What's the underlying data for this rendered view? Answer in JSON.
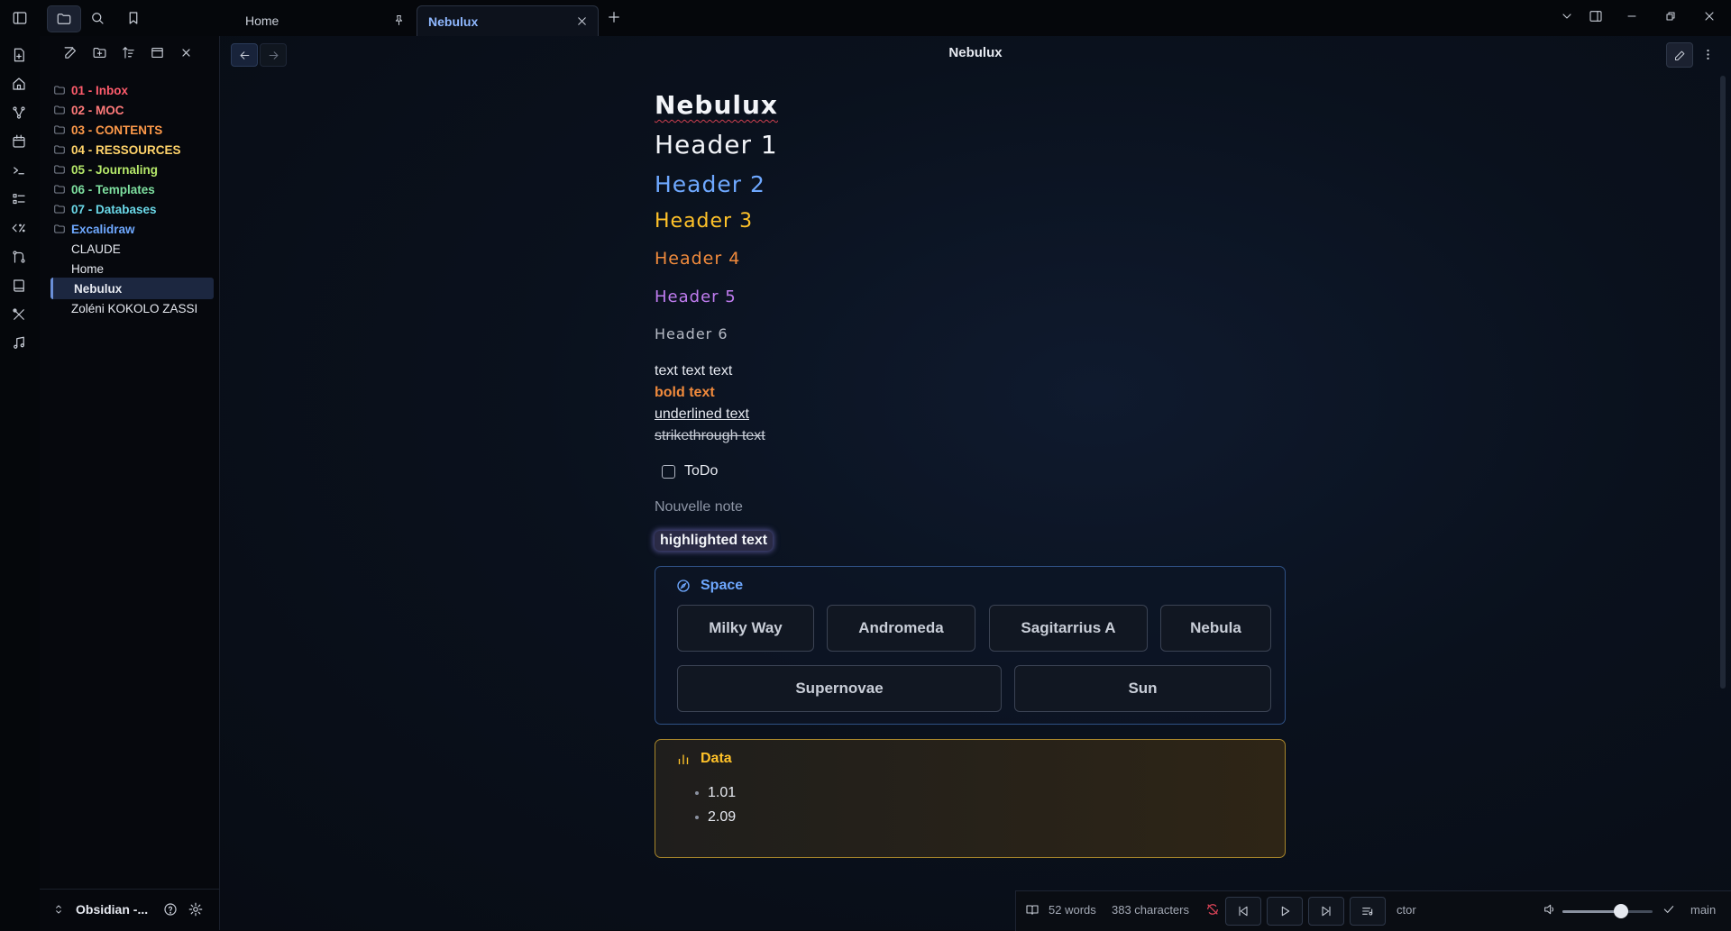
{
  "tabs": [
    {
      "label": "Home",
      "pinned": true
    },
    {
      "label": "Nebulux",
      "active": true
    }
  ],
  "sidebar": {
    "tree": [
      {
        "label": "01 - Inbox",
        "type": "folder",
        "color": "#ff5c6c"
      },
      {
        "label": "02 - MOC",
        "type": "folder",
        "color": "#ff7a7a"
      },
      {
        "label": "03 - CONTENTS",
        "type": "folder",
        "color": "#ff9a4a"
      },
      {
        "label": "04 - RESSOURCES",
        "type": "folder",
        "color": "#ffd36a"
      },
      {
        "label": "05 - Journaling",
        "type": "folder",
        "color": "#b5e86a"
      },
      {
        "label": "06 - Templates",
        "type": "folder",
        "color": "#7ee0a0"
      },
      {
        "label": "07 - Databases",
        "type": "folder",
        "color": "#6ad8e8"
      },
      {
        "label": "Excalidraw",
        "type": "folder",
        "color": "#6ea8ff"
      },
      {
        "label": "CLAUDE",
        "type": "file"
      },
      {
        "label": "Home",
        "type": "file"
      },
      {
        "label": "Nebulux",
        "type": "file",
        "selected": true
      },
      {
        "label": "Zoléni KOKOLO ZASSI",
        "type": "file"
      }
    ],
    "vault_name": "Obsidian -..."
  },
  "view": {
    "title": "Nebulux"
  },
  "document": {
    "inline_title": "Nebulux",
    "headers": [
      "Header 1",
      "Header 2",
      "Header 3",
      "Header 4",
      "Header 5",
      "Header 6"
    ],
    "plain_text": "text text text",
    "bold_text": "bold text",
    "underlined_text": "underlined text",
    "strikethrough_text": "strikethrough text",
    "todo_label": "ToDo",
    "todo_checked": false,
    "placeholder_note": "Nouvelle note",
    "highlighted_text": "highlighted text",
    "space_callout": {
      "title": "Space",
      "items": [
        "Milky Way",
        "Andromeda",
        "Sagitarrius A",
        "Nebula",
        "Supernovae",
        "Sun"
      ]
    },
    "data_callout": {
      "title": "Data",
      "items": [
        "1.01",
        "2.09"
      ]
    }
  },
  "status_bar": {
    "words": "52 words",
    "characters": "383 characters",
    "track_text": "ctor",
    "volume_percent": 65,
    "branch": "main"
  },
  "colors": {
    "accent": "#6ea8ff",
    "h3": "#ffc229",
    "h4": "#f08a3c",
    "h5": "#c07cf0"
  }
}
